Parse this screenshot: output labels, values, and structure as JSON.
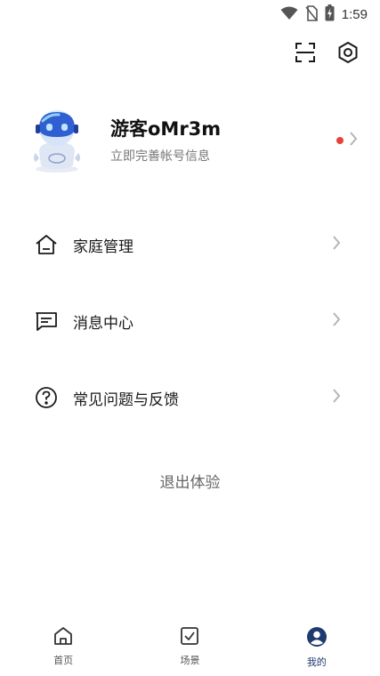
{
  "status_bar": {
    "time": "1:59",
    "icons": [
      "wifi-icon",
      "no-sim-icon",
      "battery-charging-icon"
    ]
  },
  "header": {
    "actions": [
      "scan-icon",
      "settings-icon"
    ]
  },
  "profile": {
    "name": "游客oMr3m",
    "subtitle": "立即完善帐号信息",
    "has_notification_dot": true
  },
  "menu": {
    "items": [
      {
        "label": "家庭管理",
        "icon": "home-icon"
      },
      {
        "label": "消息中心",
        "icon": "message-icon"
      },
      {
        "label": "常见问题与反馈",
        "icon": "help-icon"
      }
    ]
  },
  "logout_label": "退出体验",
  "tabbar": {
    "tabs": [
      {
        "label": "首页",
        "icon": "home-tab-icon",
        "active": false
      },
      {
        "label": "场景",
        "icon": "scene-checkbox-icon",
        "active": false
      },
      {
        "label": "我的",
        "icon": "profile-tab-icon",
        "active": true
      }
    ]
  },
  "colors": {
    "accent": "#1f3a6e",
    "notification_dot": "#e5423b",
    "chevron": "#b5b5b5"
  }
}
